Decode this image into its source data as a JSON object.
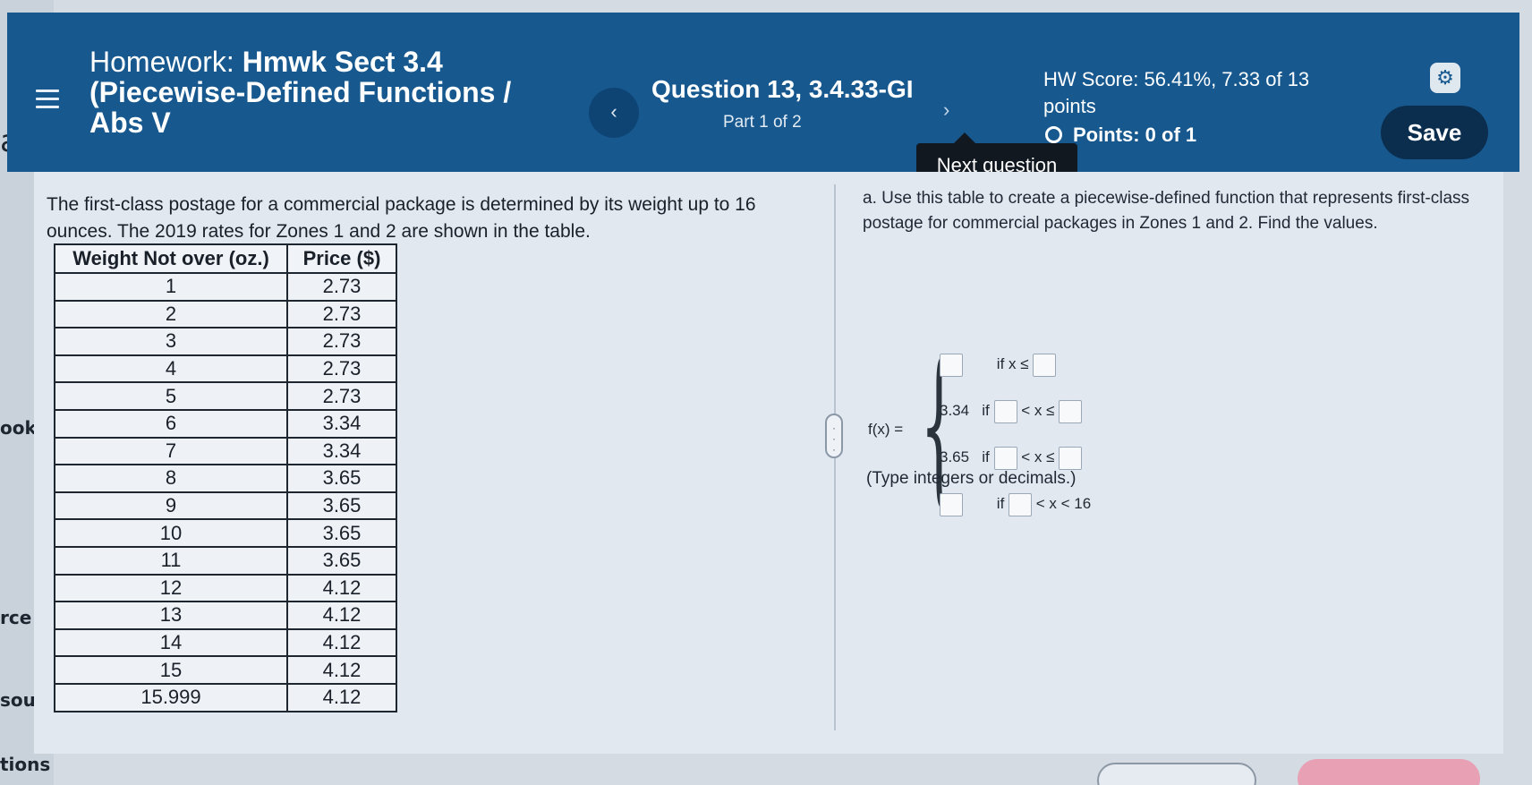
{
  "left_fragments": [
    "a",
    "ook",
    "rce",
    "sourc",
    "tions"
  ],
  "header": {
    "title_prefix": "Homework:",
    "title_main": "Hmwk Sect 3.4",
    "title_line2": "(Piecewise-Defined Functions /",
    "title_line3": "Abs V",
    "question": "Question 13, 3.4.33-GI",
    "part": "Part 1 of 2",
    "hw_score_line1": "HW Score: 56.41%, 7.33 of 13",
    "hw_score_line2": "points",
    "points": "Points: 0 of 1",
    "save_label": "Save",
    "prev_glyph": "‹",
    "next_glyph": "›"
  },
  "tooltip": "Next question",
  "problem": {
    "text": "The first-class postage for a commercial package is determined by its weight up to 16 ounces. The 2019 rates for Zones 1 and 2 are shown in the table.",
    "table": {
      "headers": [
        "Weight Not over (oz.)",
        "Price ($)"
      ],
      "rows": [
        [
          "1",
          "2.73"
        ],
        [
          "2",
          "2.73"
        ],
        [
          "3",
          "2.73"
        ],
        [
          "4",
          "2.73"
        ],
        [
          "5",
          "2.73"
        ],
        [
          "6",
          "3.34"
        ],
        [
          "7",
          "3.34"
        ],
        [
          "8",
          "3.65"
        ],
        [
          "9",
          "3.65"
        ],
        [
          "10",
          "3.65"
        ],
        [
          "11",
          "3.65"
        ],
        [
          "12",
          "4.12"
        ],
        [
          "13",
          "4.12"
        ],
        [
          "14",
          "4.12"
        ],
        [
          "15",
          "4.12"
        ],
        [
          "15.999",
          "4.12"
        ]
      ]
    }
  },
  "answer": {
    "instruction": "a. Use this table to create a piecewise-defined function that represents first-class postage for commercial packages in Zones 1 and 2. Find the values.",
    "fx_label": "f(x) =",
    "rows": [
      {
        "value": "",
        "cond": "if x ≤"
      },
      {
        "value": "3.34",
        "cond": "if",
        "mid": "< x ≤"
      },
      {
        "value": "3.65",
        "cond": "if",
        "mid": "< x ≤"
      },
      {
        "value": "",
        "cond": "if",
        "mid": "< x < 16"
      }
    ],
    "note": "(Type integers or decimals.)"
  }
}
